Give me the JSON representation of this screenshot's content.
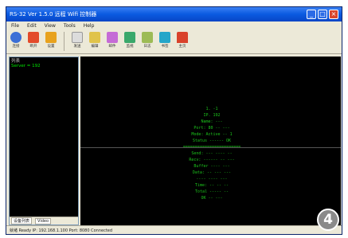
{
  "window": {
    "title": "RS-32 Ver 1.5.0 远程 Wifi 控制器"
  },
  "menu": {
    "items": [
      "File",
      "Edit",
      "View",
      "Tools",
      "Help"
    ]
  },
  "toolbar": {
    "buttons": [
      {
        "label": "连接",
        "icon": "connect-icon",
        "color": "#3b6fd6"
      },
      {
        "label": "断开",
        "icon": "disconnect-icon",
        "color": "#e34b2a"
      },
      {
        "label": "设置",
        "icon": "settings-icon",
        "color": "#e8a21d"
      },
      {
        "label": "发送",
        "icon": "send-icon",
        "color": "#dcdcdc"
      },
      {
        "label": "编辑",
        "icon": "edit-icon",
        "color": "#e0c34a"
      },
      {
        "label": "邮件",
        "icon": "mail-icon",
        "color": "#c56bd6"
      },
      {
        "label": "监视",
        "icon": "monitor-icon",
        "color": "#3aa86b"
      },
      {
        "label": "日志",
        "icon": "log-icon",
        "color": "#9dbb55"
      },
      {
        "label": "书签",
        "icon": "bookmark-icon",
        "color": "#25a6c9"
      },
      {
        "label": "主页",
        "icon": "home-icon",
        "color": "#d9422b"
      }
    ]
  },
  "left_pane": {
    "header": "列表",
    "items": [
      "Server = 192"
    ],
    "tabs": [
      "设备列表",
      "Video"
    ]
  },
  "console": {
    "lines": [
      "1. -1",
      "IP. 192",
      "Name: ---",
      "Port: 80 -- ---",
      "Mode: Active -- 1",
      "Status ------ OK",
      "========================",
      "Send: --- ---- --",
      "Recv: ------ -- ---",
      "Buffer ---- ---",
      "Data: -- --- ---",
      "---- ---- ---",
      "Time: -- -- --",
      "Total ----- --",
      "OK -- ---"
    ]
  },
  "statusbar": {
    "text": "就绪  Ready  IP: 192.168.1.100  Port: 8080  Connected"
  },
  "badge": {
    "text": "4"
  }
}
